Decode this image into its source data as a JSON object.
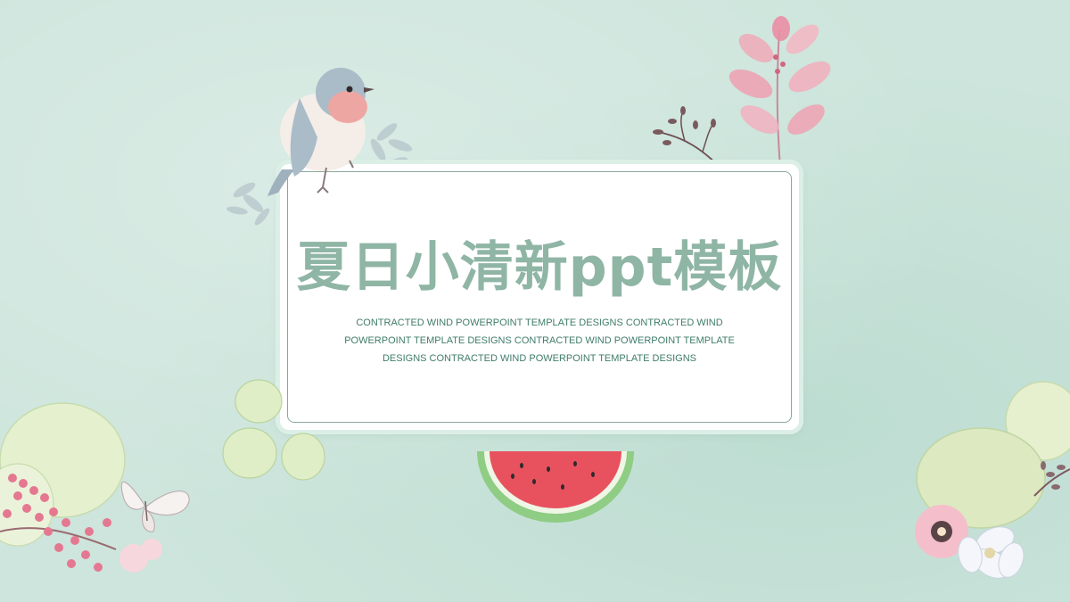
{
  "slide": {
    "title": "夏日小清新ppt模板",
    "subtitle": "CONTRACTED WIND POWERPOINT TEMPLATE DESIGNS CONTRACTED WIND POWERPOINT TEMPLATE DESIGNS CONTRACTED WIND POWERPOINT TEMPLATE DESIGNS CONTRACTED WIND POWERPOINT TEMPLATE DESIGNS"
  },
  "colors": {
    "background": "#cde5dc",
    "title": "#8fb5a5",
    "subtitle": "#3f7c6a",
    "card_border": "#8aa89b"
  },
  "decorations": {
    "bird": "bird-illustration",
    "watermelon": "watermelon-slice-illustration",
    "pink_leaves": "pink-leaf-branch-illustration",
    "butterfly": "butterfly-illustration"
  }
}
